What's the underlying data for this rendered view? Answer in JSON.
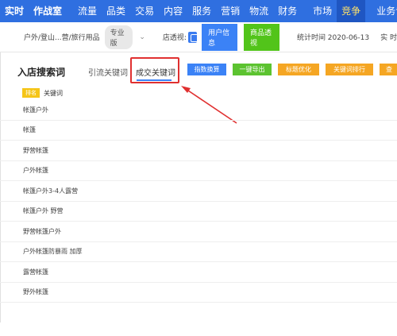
{
  "topnav": {
    "items": [
      {
        "label": "实时"
      },
      {
        "label": "作战室"
      },
      {
        "label": "流量"
      },
      {
        "label": "品类"
      },
      {
        "label": "交易"
      },
      {
        "label": "内容"
      },
      {
        "label": "服务"
      },
      {
        "label": "营销"
      },
      {
        "label": "物流"
      },
      {
        "label": "财务"
      },
      {
        "label": "市场"
      },
      {
        "label": "竞争"
      },
      {
        "label": "业务专区"
      }
    ],
    "active": "竞争"
  },
  "toolbar": {
    "path": "户外/登山...营/旅行用品",
    "version": "专业版",
    "chevron": "⌄",
    "perspective_label": "店透视:",
    "user_info_button": "用户信息",
    "product_view_button": "商品透视",
    "stat_time": "统计时间 2020-06-13",
    "realtime": "实 时"
  },
  "section": {
    "title": "入店搜索词",
    "tab_traffic": "引流关键词",
    "tab_deal": "成交关键词"
  },
  "actions": {
    "index_convert": "指数换算",
    "export": "一键导出",
    "title_optimize": "标题优化",
    "keyword_rank": "关键词排行",
    "more": "查"
  },
  "table": {
    "rank_badge": "排名",
    "column_keyword": "关键词",
    "rows": [
      "帐篷户外",
      "帐篷",
      "野营帐篷",
      "户外帐篷",
      "帐篷户外3-4人露营",
      "帐篷户外 野营",
      "野营帐篷户外",
      "户外帐篷防暴雨 加厚",
      "露营帐篷",
      "野外帐篷"
    ]
  },
  "colors": {
    "nav_bg": "#2f6fe0",
    "highlight": "#e03030",
    "accent_blue": "#3b82f6",
    "green": "#52c41a",
    "orange": "#f5a623"
  }
}
